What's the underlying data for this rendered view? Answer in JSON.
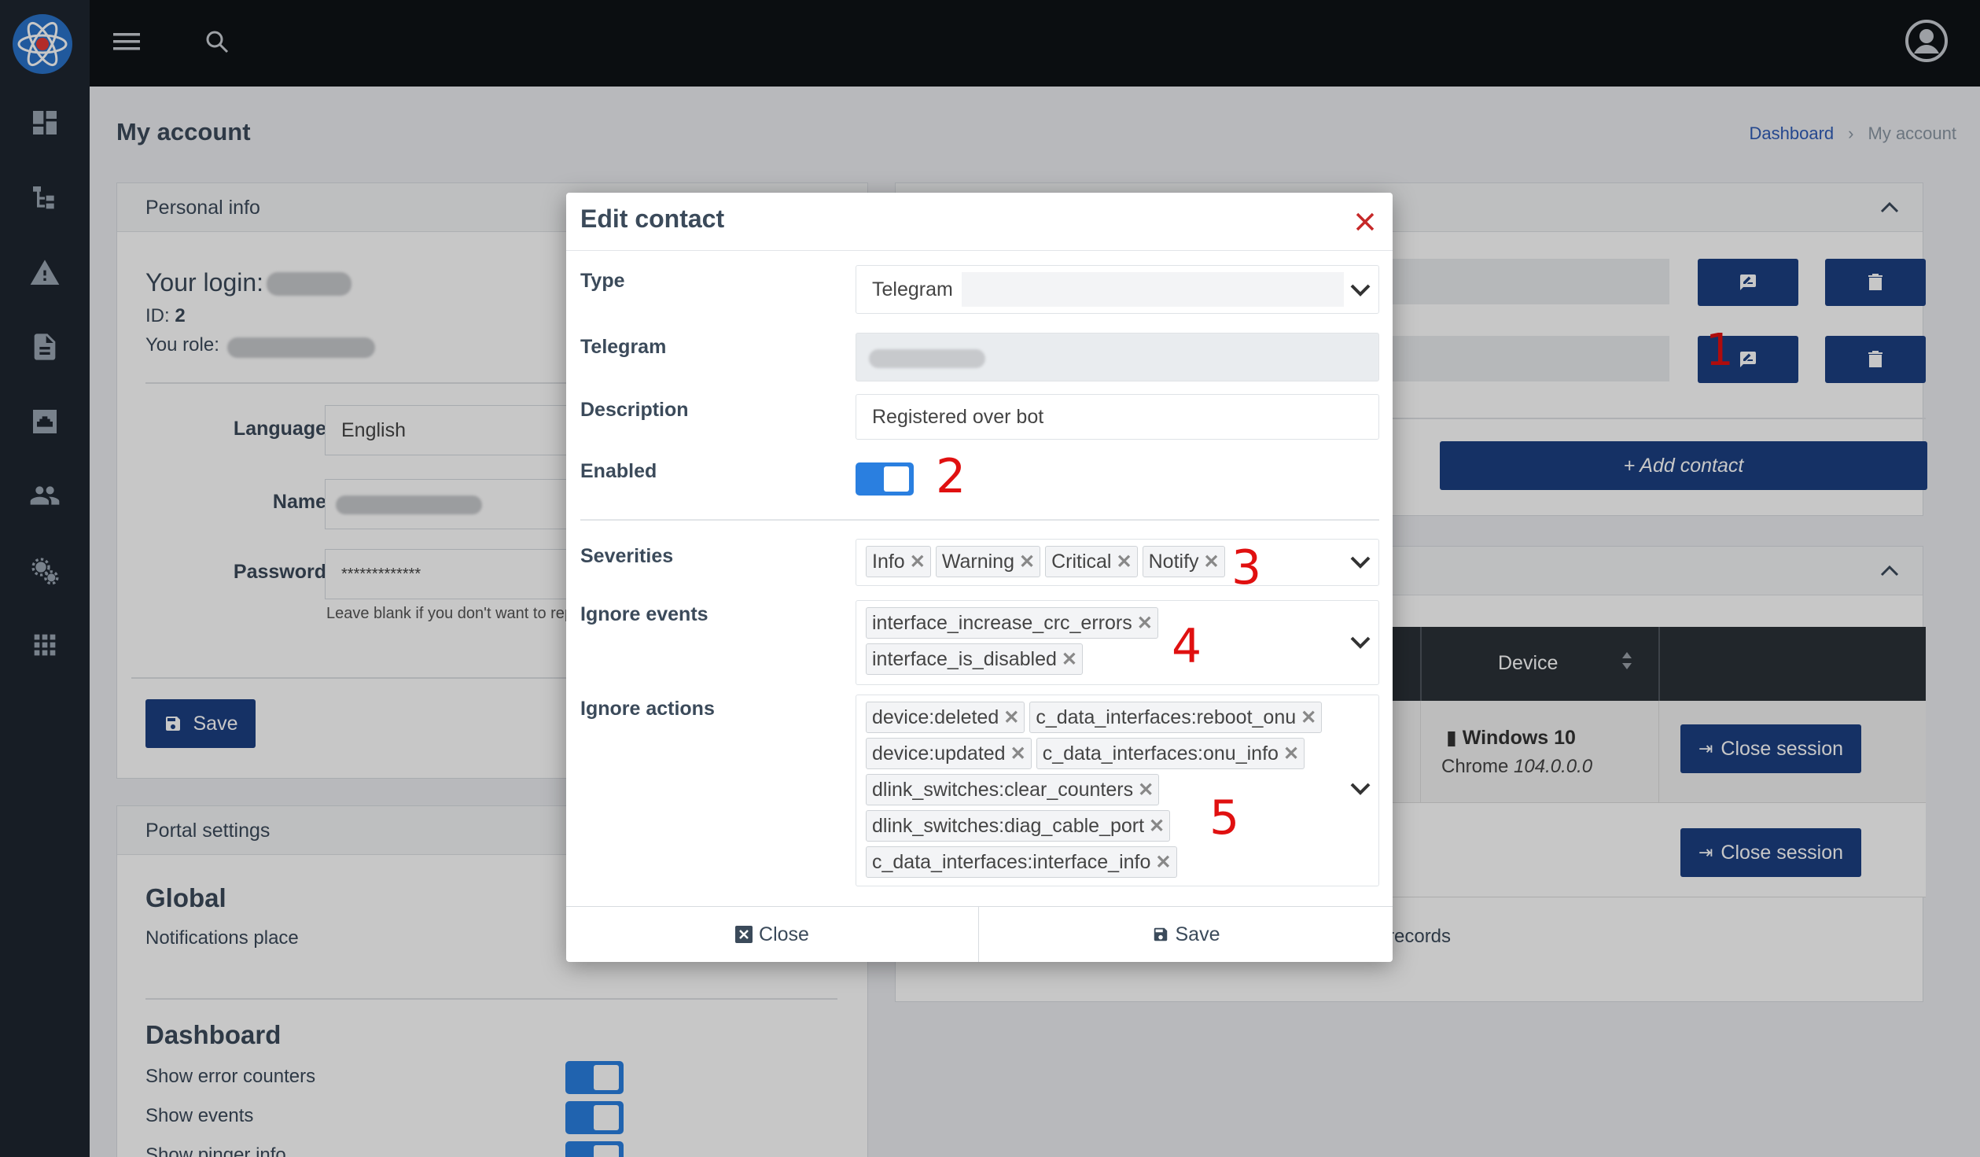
{
  "page": {
    "title": "My account",
    "breadcrumb": {
      "home": "Dashboard",
      "current": "My account"
    }
  },
  "sidebar": {
    "items": [
      {
        "icon": "dashboard-icon"
      },
      {
        "icon": "tree-icon"
      },
      {
        "icon": "warning-icon"
      },
      {
        "icon": "document-icon"
      },
      {
        "icon": "network-port-icon"
      },
      {
        "icon": "users-icon"
      },
      {
        "icon": "settings-icon"
      },
      {
        "icon": "apps-grid-icon"
      }
    ]
  },
  "personal": {
    "header": "Personal info",
    "login_label": "Your login:",
    "id_label": "ID:",
    "id_value": "2",
    "role_label": "You role:",
    "language_label": "Language",
    "language_value": "English",
    "name_label": "Name",
    "password_label": "Password",
    "password_value": "*************",
    "password_hint": "Leave blank if you don't want to rep",
    "save_label": "Save"
  },
  "portal": {
    "header": "Portal settings",
    "global_title": "Global",
    "notifications_label": "Notifications place",
    "dashboard_title": "Dashboard",
    "toggles": [
      "Show error counters",
      "Show events",
      "Show pinger info"
    ]
  },
  "contacts": {
    "add_label": "+ Add contact"
  },
  "sessions": {
    "device_col": "Device",
    "rows": [
      {
        "os": "Windows 10",
        "browser": "Chrome",
        "version": "104.0.0.0",
        "action": "Close session"
      },
      {
        "action": "Close session"
      }
    ],
    "footer": "records"
  },
  "modal": {
    "title": "Edit contact",
    "type_label": "Type",
    "type_value": "Telegram",
    "telegram_label": "Telegram",
    "description_label": "Description",
    "description_value": "Registered over bot",
    "enabled_label": "Enabled",
    "severities_label": "Severities",
    "severities": [
      "Info",
      "Warning",
      "Critical",
      "Notify"
    ],
    "ignore_events_label": "Ignore events",
    "ignore_events": [
      "interface_increase_crc_errors",
      "interface_is_disabled"
    ],
    "ignore_actions_label": "Ignore actions",
    "ignore_actions": [
      "device:deleted",
      "c_data_interfaces:reboot_onu",
      "device:updated",
      "c_data_interfaces:onu_info",
      "dlink_switches:clear_counters",
      "dlink_switches:diag_cable_port",
      "c_data_interfaces:interface_info"
    ],
    "close_label": "Close",
    "save_label": "Save"
  },
  "annotations": [
    "1",
    "2",
    "3",
    "4",
    "5"
  ],
  "colors": {
    "accent": "#1c3f82",
    "toggle": "#2a7fe0",
    "annotation": "#e01010",
    "sidebar": "#1e2630"
  }
}
